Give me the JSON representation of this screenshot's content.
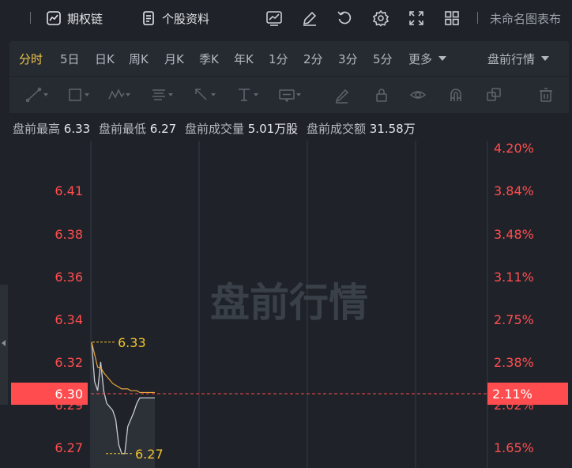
{
  "topbar": {
    "options_label": "期权链",
    "profile_label": "个股资料",
    "chart_name": "未命名图表布"
  },
  "periods": [
    {
      "label": "分时",
      "active": true
    },
    {
      "label": "5日"
    },
    {
      "label": "日K"
    },
    {
      "label": "周K"
    },
    {
      "label": "月K"
    },
    {
      "label": "季K"
    },
    {
      "label": "年K"
    },
    {
      "label": "1分"
    },
    {
      "label": "2分"
    },
    {
      "label": "3分"
    },
    {
      "label": "5分"
    },
    {
      "label": "更多"
    }
  ],
  "session_label": "盘前行情",
  "stats": {
    "high_label": "盘前最高",
    "high": "6.33",
    "low_label": "盘前最低",
    "low": "6.27",
    "volume_label": "盘前成交量",
    "volume": "5.01万股",
    "turnover_label": "盘前成交额",
    "turnover": "31.58万"
  },
  "colors": {
    "down": "#ff4d4f",
    "price_line": "#c8ccd2",
    "avg_line": "#e8a33a",
    "marker": "#f0c42a",
    "watermark": "#3a4048"
  },
  "chart_data": {
    "type": "line",
    "watermark": "盘前行情",
    "y_ticks": [
      "6.41",
      "6.38",
      "6.36",
      "6.34",
      "6.32",
      "6.29",
      "6.27"
    ],
    "pct_ticks": [
      "4.20%",
      "3.84%",
      "3.48%",
      "3.11%",
      "2.75%",
      "2.38%",
      "2.02%",
      "1.65%"
    ],
    "current_price": "6.30",
    "current_pct": "2.11%",
    "high_marker": "6.33",
    "low_marker": "6.27",
    "price_series": [
      6.332,
      6.31,
      6.305,
      6.321,
      6.305,
      6.298,
      6.296,
      6.294,
      6.289,
      6.275,
      6.27,
      6.27,
      6.285,
      6.289,
      6.293,
      6.298,
      6.301,
      6.301,
      6.301,
      6.301,
      6.301,
      6.301
    ],
    "avg_series": [
      6.332,
      6.325,
      6.318,
      6.318,
      6.315,
      6.313,
      6.311,
      6.309,
      6.308,
      6.307,
      6.306,
      6.306,
      6.306,
      6.305,
      6.305,
      6.305,
      6.304,
      6.304,
      6.304,
      6.304,
      6.304,
      6.304
    ],
    "y_range": [
      6.262,
      6.444
    ],
    "grid": true
  }
}
